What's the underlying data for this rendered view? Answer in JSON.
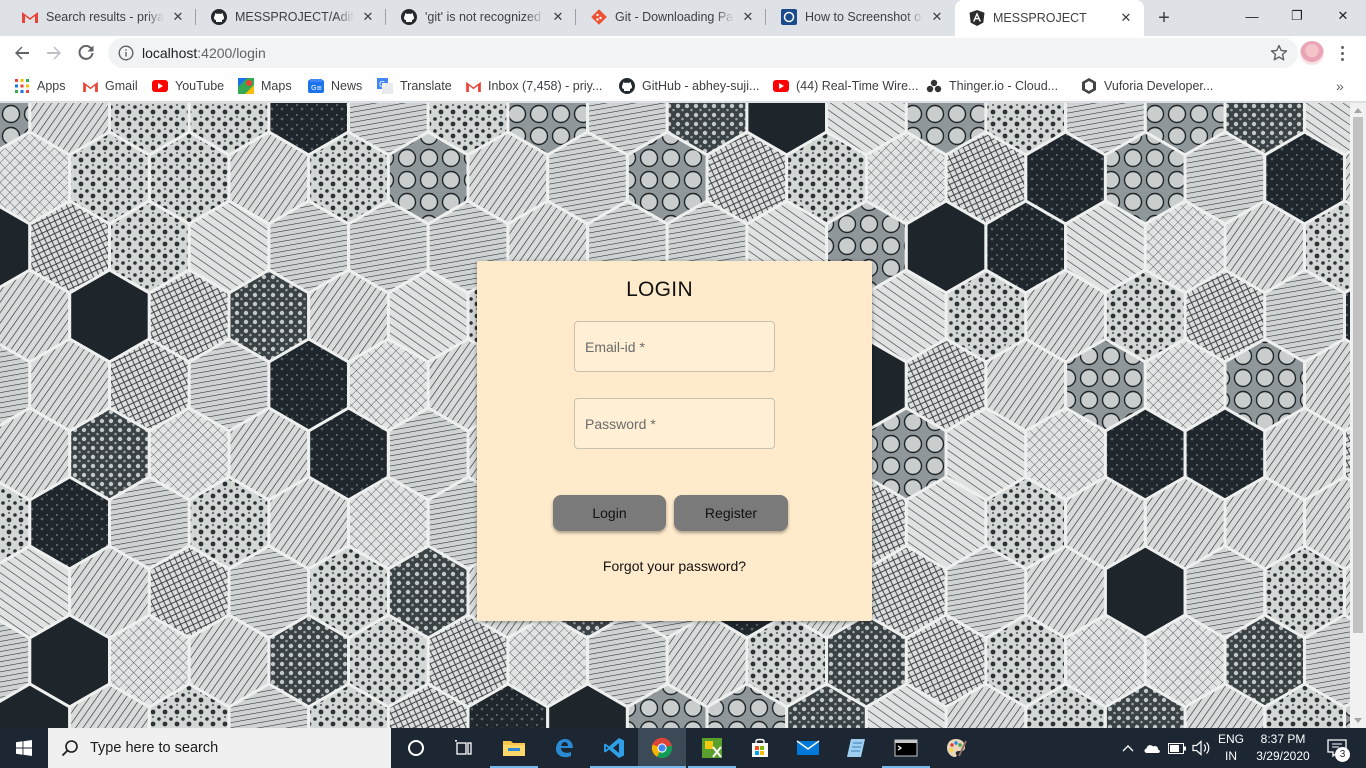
{
  "browser": {
    "tabs": [
      {
        "title": "Search results - priyank",
        "icon": "gmail-icon"
      },
      {
        "title": "MESSPROJECT/Adiflex.r",
        "icon": "github-icon"
      },
      {
        "title": "'git' is not recognized a",
        "icon": "github-icon"
      },
      {
        "title": "Git - Downloading Pack",
        "icon": "git-icon"
      },
      {
        "title": "How to Screenshot on P",
        "icon": "site-icon"
      },
      {
        "title": "MESSPROJECT",
        "icon": "angular-icon",
        "active": true
      }
    ],
    "new_tab": "+",
    "window_controls": {
      "minimize": "—",
      "maximize": "❐",
      "close": "✕"
    },
    "url_host": "localhost",
    "url_rest": ":4200/login",
    "bookmarks": [
      {
        "label": "Apps",
        "icon": "apps-grid-icon"
      },
      {
        "label": "Gmail",
        "icon": "gmail-icon"
      },
      {
        "label": "YouTube",
        "icon": "youtube-icon"
      },
      {
        "label": "Maps",
        "icon": "maps-icon"
      },
      {
        "label": "News",
        "icon": "news-icon"
      },
      {
        "label": "Translate",
        "icon": "translate-icon"
      },
      {
        "label": "Inbox (7,458) - priy...",
        "icon": "gmail-icon"
      },
      {
        "label": "GitHub - abhey-suji...",
        "icon": "github-icon"
      },
      {
        "label": "(44) Real-Time Wire...",
        "icon": "youtube-icon"
      },
      {
        "label": "Thinger.io - Cloud...",
        "icon": "thinger-icon"
      },
      {
        "label": "Vuforia Developer...",
        "icon": "vuforia-icon"
      }
    ],
    "bookmarks_overflow": "»"
  },
  "login": {
    "title": "LOGIN",
    "email_placeholder": "Email-id *",
    "password_placeholder": "Password *",
    "login_button": "Login",
    "register_button": "Register",
    "forgot_link": "Forgot your password?",
    "card_color": "#ffebcc",
    "button_color": "#7a7a7a"
  },
  "taskbar": {
    "search_placeholder": "Type here to search",
    "language_line1": "ENG",
    "language_line2": "IN",
    "time": "8:37 PM",
    "date": "3/29/2020",
    "notification_count": "3"
  }
}
